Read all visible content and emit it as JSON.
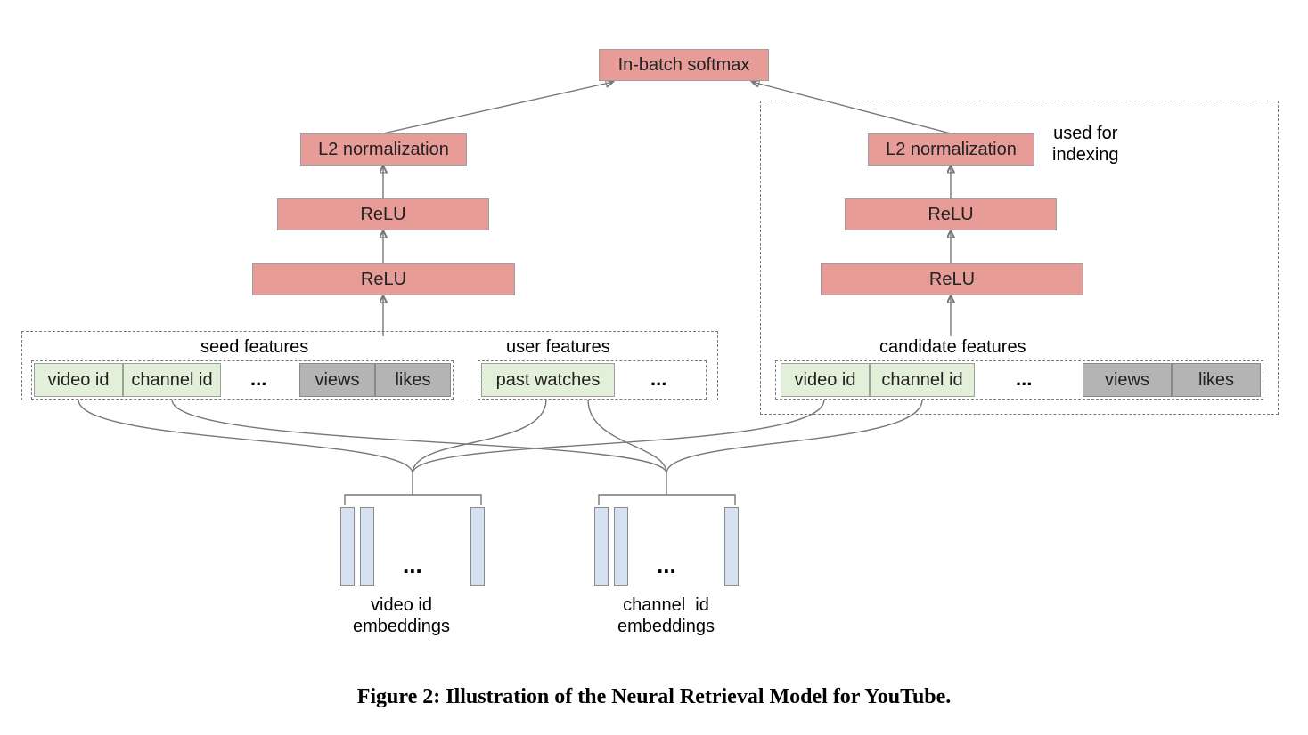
{
  "top": {
    "softmax": "In-batch softmax"
  },
  "left_tower": {
    "l2": "L2 normalization",
    "relu1": "ReLU",
    "relu2": "ReLU"
  },
  "right_tower": {
    "l2": "L2 normalization",
    "relu1": "ReLU",
    "relu2": "ReLU"
  },
  "indexing_note": "used for\nindexing",
  "sections": {
    "seed": "seed features",
    "user": "user features",
    "candidate": "candidate features"
  },
  "feat": {
    "video_id": "video id",
    "channel_id": "channel id",
    "views": "views",
    "likes": "likes",
    "past_watches": "past watches"
  },
  "ellipsis": "...",
  "emb": {
    "video": "video id\nembeddings",
    "channel": "channel  id\nembeddings"
  },
  "caption": "Figure 2: Illustration of the Neural Retrieval Model for YouTube."
}
